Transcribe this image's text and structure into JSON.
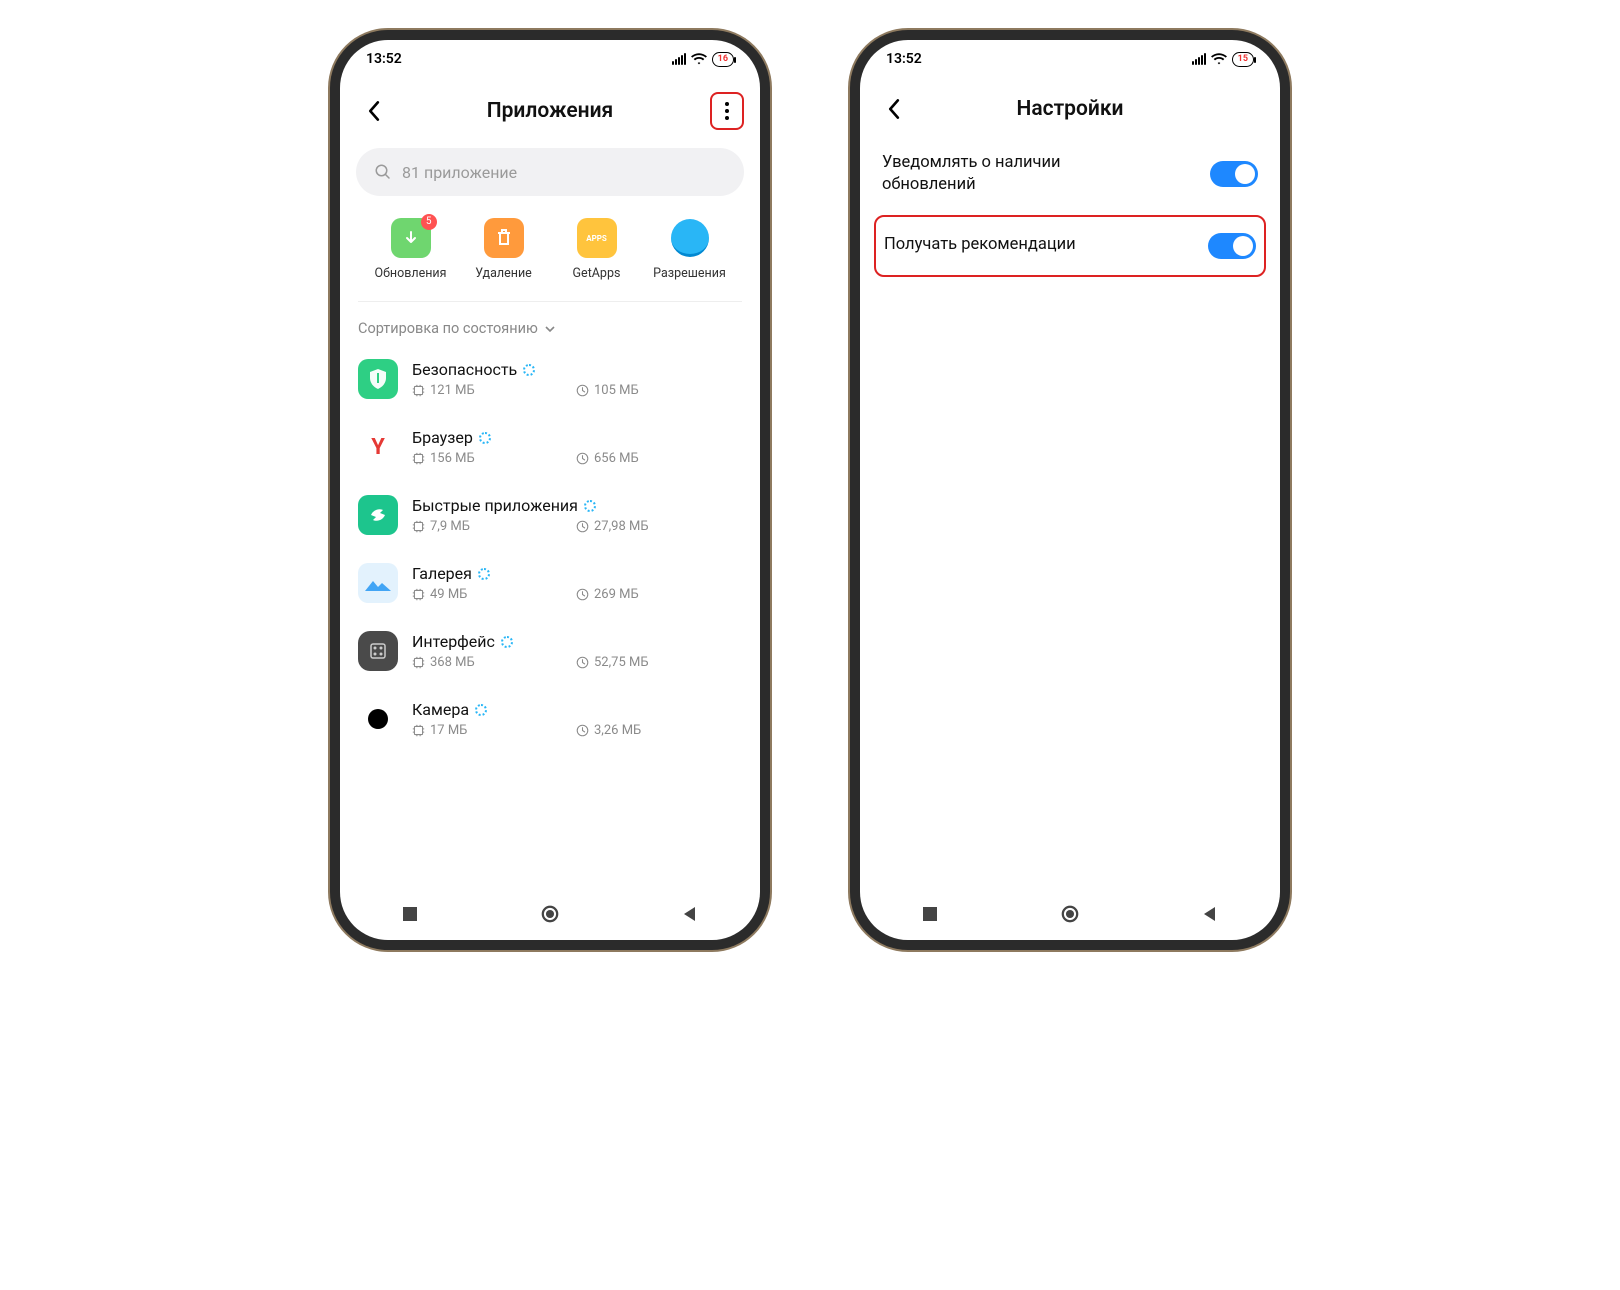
{
  "left": {
    "status": {
      "time": "13:52",
      "battery": "16"
    },
    "title": "Приложения",
    "search_placeholder": "81 приложение",
    "quick": [
      {
        "label": "Обновления",
        "badge": "5"
      },
      {
        "label": "Удаление"
      },
      {
        "label": "GetApps"
      },
      {
        "label": "Разрешения"
      }
    ],
    "sort_label": "Сортировка по состоянию",
    "apps": [
      {
        "name": "Безопасность",
        "storage": "121 МБ",
        "time": "105 МБ"
      },
      {
        "name": "Браузер",
        "storage": "156 МБ",
        "time": "656 МБ"
      },
      {
        "name": "Быстрые приложения",
        "storage": "7,9 МБ",
        "time": "27,98 МБ"
      },
      {
        "name": "Галерея",
        "storage": "49 МБ",
        "time": "269 МБ"
      },
      {
        "name": "Интерфейс",
        "storage": "368 МБ",
        "time": "52,75 МБ"
      },
      {
        "name": "Камера",
        "storage": "17 МБ",
        "time": "3,26 МБ"
      }
    ]
  },
  "right": {
    "status": {
      "time": "13:52",
      "battery": "15"
    },
    "title": "Настройки",
    "settings": [
      {
        "label": "Уведомлять о наличии обновлений",
        "enabled": true
      },
      {
        "label": "Получать рекомендации",
        "enabled": true
      }
    ]
  }
}
